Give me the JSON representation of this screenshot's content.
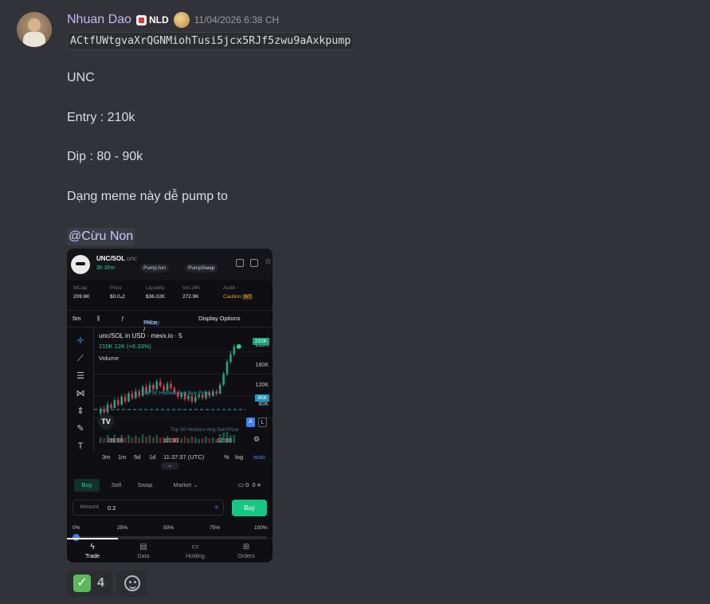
{
  "message": {
    "username": "Nhuan Dao",
    "guild_tag": "NLD",
    "timestamp": "11/04/2026 6:38 CH",
    "contract_code": "ACtfUWtgvaXrQGNMiohTusi5jcx5RJf5zwu9aAxkpump",
    "lines": [
      "UNC",
      "Entry : 210k",
      "Dip : 80 - 90k",
      "Dạng meme này dễ pump to"
    ],
    "mention": "@Cừu Non"
  },
  "screenshot": {
    "pair": "UNC/SOL",
    "ticker": "unc",
    "age": "3h 35m",
    "pill_pumpfun": "Pump.fun",
    "pill_pumpswap": "PumpSwap",
    "stats": [
      {
        "label": "MCap",
        "value": "209.6K"
      },
      {
        "label": "Price",
        "value": "$0.0₄2"
      },
      {
        "label": "Liquidity",
        "value": "$36.02K"
      },
      {
        "label": "Vol 24h",
        "value": "272.9K"
      },
      {
        "label": "Audit ›",
        "value": "Caution"
      }
    ],
    "audit_badge": "6/7",
    "toolbar": {
      "interval": "5m",
      "price_label": "Price /",
      "mcap_label": "MCap",
      "display_options": "Display Options"
    },
    "chart_title": "unc/SOL in USD · mevx.io · 5",
    "chart_change": "210K  12K (+6.33%)",
    "chart_volume": "Volume",
    "y_labels": [
      "200K",
      "160K",
      "120K",
      "80K"
    ],
    "y_tag_current": "210K",
    "y_tag_holders": "95K",
    "holders_line": "Top 50 Holders Avg Buy Price",
    "sell_line": "Top 50 Holders Avg Sell Price",
    "x_labels": [
      "09:00",
      "10:30",
      "12:00"
    ],
    "ranges": [
      "3m",
      "1m",
      "5d",
      "1d"
    ],
    "clock": "11:37:37 (UTC)",
    "scale_opts": [
      "%",
      "log",
      "auto"
    ],
    "trade_tabs": [
      "Buy",
      "Sell",
      "Swap"
    ],
    "market_label": "Market",
    "amount_label": "Amount",
    "amount_value": "0.2",
    "buy_button": "Buy",
    "wallet_count": "0",
    "wallet_value": "0",
    "percent_marks": [
      "0%",
      "25%",
      "50%",
      "75%",
      "100%"
    ],
    "slider_fraction": 0,
    "nav": [
      "Trade",
      "Data",
      "Holding",
      "Orders"
    ]
  },
  "reactions": [
    {
      "emoji": "check-mark",
      "count": "4"
    }
  ],
  "colors": {
    "background": "#323339",
    "username": "#c9b4f2",
    "mention_bg": "#3b3c46",
    "candle_up": "#26a17b",
    "candle_down": "#d6394f",
    "buy_green": "#16c784"
  },
  "chart_data": {
    "type": "bar",
    "title": "unc/SOL in USD · mevx.io · 5",
    "x": [
      "09:00",
      "10:30",
      "12:00"
    ],
    "ylim": [
      60,
      220
    ],
    "yticks": [
      80,
      120,
      160,
      200
    ],
    "candles": [
      {
        "o": 88,
        "c": 96,
        "h": 100,
        "l": 84
      },
      {
        "o": 96,
        "c": 90,
        "h": 102,
        "l": 86
      },
      {
        "o": 90,
        "c": 104,
        "h": 110,
        "l": 88
      },
      {
        "o": 104,
        "c": 98,
        "h": 108,
        "l": 94
      },
      {
        "o": 98,
        "c": 112,
        "h": 116,
        "l": 96
      },
      {
        "o": 112,
        "c": 104,
        "h": 118,
        "l": 100
      },
      {
        "o": 104,
        "c": 118,
        "h": 122,
        "l": 102
      },
      {
        "o": 118,
        "c": 110,
        "h": 124,
        "l": 106
      },
      {
        "o": 110,
        "c": 124,
        "h": 128,
        "l": 108
      },
      {
        "o": 124,
        "c": 116,
        "h": 130,
        "l": 112
      },
      {
        "o": 116,
        "c": 128,
        "h": 134,
        "l": 114
      },
      {
        "o": 128,
        "c": 120,
        "h": 132,
        "l": 116
      },
      {
        "o": 120,
        "c": 136,
        "h": 140,
        "l": 118
      },
      {
        "o": 136,
        "c": 126,
        "h": 142,
        "l": 122
      },
      {
        "o": 126,
        "c": 140,
        "h": 146,
        "l": 124
      },
      {
        "o": 140,
        "c": 132,
        "h": 144,
        "l": 128
      },
      {
        "o": 132,
        "c": 146,
        "h": 150,
        "l": 130
      },
      {
        "o": 146,
        "c": 138,
        "h": 152,
        "l": 134
      },
      {
        "o": 138,
        "c": 130,
        "h": 142,
        "l": 126
      },
      {
        "o": 130,
        "c": 142,
        "h": 146,
        "l": 128
      },
      {
        "o": 142,
        "c": 134,
        "h": 148,
        "l": 130
      },
      {
        "o": 134,
        "c": 126,
        "h": 138,
        "l": 122
      },
      {
        "o": 126,
        "c": 118,
        "h": 130,
        "l": 114
      },
      {
        "o": 118,
        "c": 124,
        "h": 128,
        "l": 114
      },
      {
        "o": 124,
        "c": 114,
        "h": 128,
        "l": 110
      },
      {
        "o": 114,
        "c": 120,
        "h": 124,
        "l": 110
      },
      {
        "o": 120,
        "c": 110,
        "h": 124,
        "l": 106
      },
      {
        "o": 110,
        "c": 118,
        "h": 122,
        "l": 106
      },
      {
        "o": 118,
        "c": 122,
        "h": 126,
        "l": 114
      },
      {
        "o": 122,
        "c": 116,
        "h": 126,
        "l": 112
      },
      {
        "o": 116,
        "c": 126,
        "h": 130,
        "l": 112
      },
      {
        "o": 126,
        "c": 120,
        "h": 130,
        "l": 116
      },
      {
        "o": 120,
        "c": 128,
        "h": 132,
        "l": 118
      },
      {
        "o": 128,
        "c": 124,
        "h": 132,
        "l": 120
      },
      {
        "o": 124,
        "c": 140,
        "h": 144,
        "l": 122
      },
      {
        "o": 140,
        "c": 160,
        "h": 164,
        "l": 138
      },
      {
        "o": 160,
        "c": 182,
        "h": 186,
        "l": 156
      },
      {
        "o": 182,
        "c": 196,
        "h": 202,
        "l": 178
      },
      {
        "o": 196,
        "c": 210,
        "h": 214,
        "l": 192
      }
    ]
  }
}
